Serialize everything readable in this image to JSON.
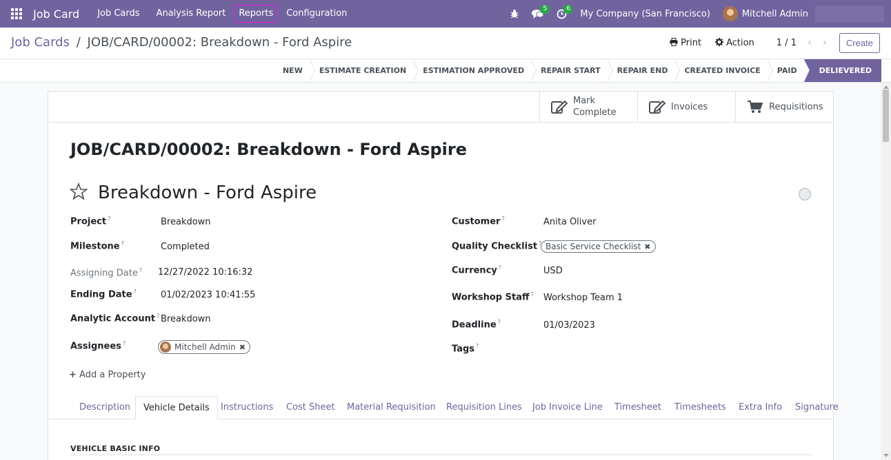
{
  "navbar": {
    "app_name": "Job Card",
    "menu": [
      "Job Cards",
      "Analysis Report",
      "Reports",
      "Configuration"
    ],
    "active_menu": "Reports",
    "messages_count": "5",
    "activities_count": "6",
    "company": "My Company (San Francisco)",
    "user": "Mitchell Admin"
  },
  "control": {
    "breadcrumb_parent": "Job Cards",
    "breadcrumb_sep": "/",
    "breadcrumb_current": "JOB/CARD/00002: Breakdown - Ford Aspire",
    "print_label": "Print",
    "action_label": "Action",
    "pager": "1 / 1",
    "create_label": "Create"
  },
  "stages": [
    "NEW",
    "ESTIMATE CREATION",
    "ESTIMATION APPROVED",
    "REPAIR START",
    "REPAIR END",
    "CREATED INVOICE",
    "PAID",
    "DELIEVERED"
  ],
  "current_stage": "DELIEVERED",
  "smart_buttons": {
    "mark_complete_1": "Mark",
    "mark_complete_2": "Complete",
    "invoices": "Invoices",
    "requisitions": "Requisitions"
  },
  "form": {
    "doc_title": "JOB/CARD/00002: Breakdown - Ford Aspire",
    "record_name": "Breakdown - Ford Aspire",
    "help_mark": "?",
    "left": {
      "project_label": "Project",
      "project": "Breakdown",
      "milestone_label": "Milestone",
      "milestone": "Completed",
      "assigning_date_label": "Assigning Date",
      "assigning_date": "12/27/2022 10:16:32",
      "ending_date_label": "Ending Date",
      "ending_date": "01/02/2023 10:41:55",
      "analytic_label": "Analytic Account",
      "analytic": "Breakdown",
      "assignees_label": "Assignees",
      "assignee": "Mitchell Admin"
    },
    "right": {
      "customer_label": "Customer",
      "customer": "Anita Oliver",
      "checklist_label": "Quality Checklist",
      "checklist": "Basic Service Checklist",
      "currency_label": "Currency",
      "currency": "USD",
      "staff_label": "Workshop Staff",
      "staff": "Workshop Team 1",
      "deadline_label": "Deadline",
      "deadline": "01/03/2023",
      "tags_label": "Tags"
    },
    "add_property": "Add a Property"
  },
  "tabs": [
    "Description",
    "Vehicle Details",
    "Instructions",
    "Cost Sheet",
    "Material Requisition",
    "Requisition Lines",
    "Job Invoice Line",
    "Timesheet",
    "Timesheets",
    "Extra Info",
    "Signature"
  ],
  "active_tab": "Vehicle Details",
  "section_title": "VEHICLE BASIC INFO",
  "colors": {
    "brand": "#71639e",
    "badge": "#28a745",
    "highlight": "#e21ae6"
  }
}
